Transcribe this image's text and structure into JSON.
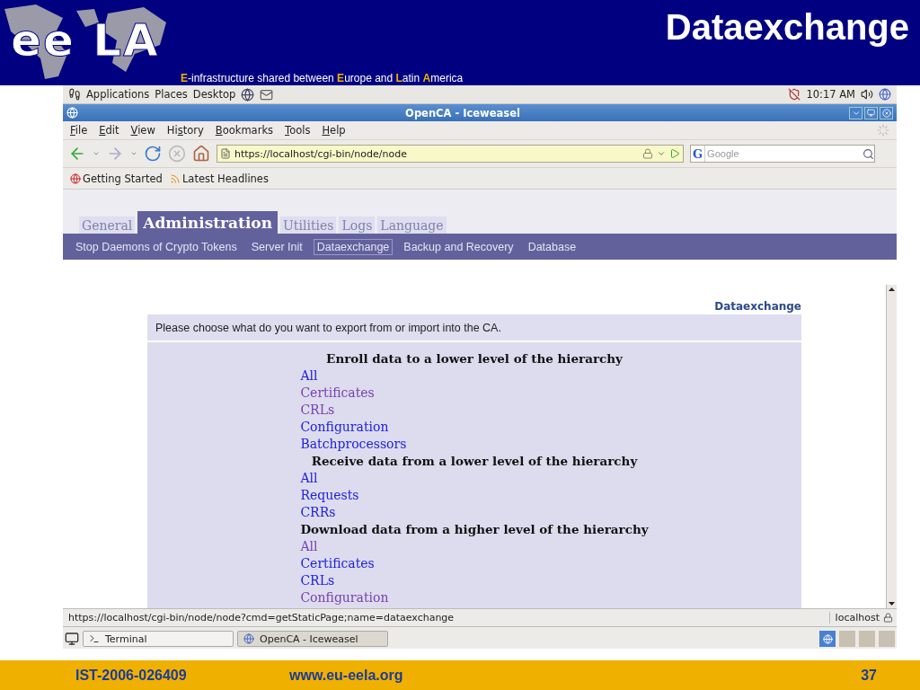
{
  "slide": {
    "logo_text": "ee LA",
    "title": "Dataexchange",
    "tagline": [
      {
        "text": "E",
        "highlight": true
      },
      {
        "text": "-infrastructure shared between ",
        "highlight": false
      },
      {
        "text": "E",
        "highlight": true
      },
      {
        "text": "urope and ",
        "highlight": false
      },
      {
        "text": "L",
        "highlight": true
      },
      {
        "text": "atin ",
        "highlight": false
      },
      {
        "text": "A",
        "highlight": true
      },
      {
        "text": "merica",
        "highlight": false
      }
    ],
    "footer": {
      "project": "IST-2006-026409",
      "website": "www.eu-eela.org",
      "page": "37"
    }
  },
  "top_panel": {
    "menus": [
      "Applications",
      "Places",
      "Desktop"
    ],
    "clock": "10:17 AM"
  },
  "window": {
    "title": "OpenCA - Iceweasel"
  },
  "menu_bar": [
    {
      "key": "F",
      "rest": "ile"
    },
    {
      "key": "E",
      "rest": "dit"
    },
    {
      "key": "V",
      "rest": "iew"
    },
    {
      "lead": "Hi",
      "key": "s",
      "rest": "tory"
    },
    {
      "key": "B",
      "rest": "ookmarks"
    },
    {
      "key": "T",
      "rest": "ools"
    },
    {
      "key": "H",
      "rest": "elp"
    }
  ],
  "address": {
    "value": "https://localhost/cgi-bin/node/node"
  },
  "search": {
    "engine": "G",
    "placeholder": "Google"
  },
  "bookmarks": [
    "Getting Started",
    "Latest Headlines"
  ],
  "tabs": [
    {
      "label": "General",
      "selected": false
    },
    {
      "label": "Administration",
      "selected": true
    },
    {
      "label": "Utilities",
      "selected": false
    },
    {
      "label": "Logs",
      "selected": false
    },
    {
      "label": "Language",
      "selected": false
    }
  ],
  "subnav": [
    {
      "label": "Stop Daemons of Crypto Tokens",
      "selected": false
    },
    {
      "label": "Server Init",
      "selected": false
    },
    {
      "label": "Dataexchange",
      "selected": true
    },
    {
      "label": "Backup and Recovery",
      "selected": false
    },
    {
      "label": "Database",
      "selected": false
    }
  ],
  "page": {
    "heading": "Dataexchange",
    "description": "Please choose what do you want to export from or import into the CA.",
    "sections": [
      {
        "heading": "Enroll data to a lower level of the hierarchy",
        "links": [
          {
            "label": "All",
            "visited": false
          },
          {
            "label": "Certificates",
            "visited": true
          },
          {
            "label": "CRLs",
            "visited": true
          },
          {
            "label": "Configuration",
            "visited": false
          },
          {
            "label": "Batchprocessors",
            "visited": false
          }
        ]
      },
      {
        "heading": "Receive data from a lower level of the hierarchy",
        "links": [
          {
            "label": "All",
            "visited": false
          },
          {
            "label": "Requests",
            "visited": false
          },
          {
            "label": "CRRs",
            "visited": false
          }
        ]
      },
      {
        "heading": "Download data from a higher level of the hierarchy",
        "links": [
          {
            "label": "All",
            "visited": true
          },
          {
            "label": "Certificates",
            "visited": false
          },
          {
            "label": "CRLs",
            "visited": false
          },
          {
            "label": "Configuration",
            "visited": true
          }
        ]
      }
    ]
  },
  "status_bar": {
    "url": "https://localhost/cgi-bin/node/node?cmd=getStaticPage;name=dataexchange",
    "host": "localhost"
  },
  "taskbar": [
    {
      "label": "Terminal",
      "selected": false
    },
    {
      "label": "OpenCA - Iceweasel",
      "selected": true
    }
  ]
}
